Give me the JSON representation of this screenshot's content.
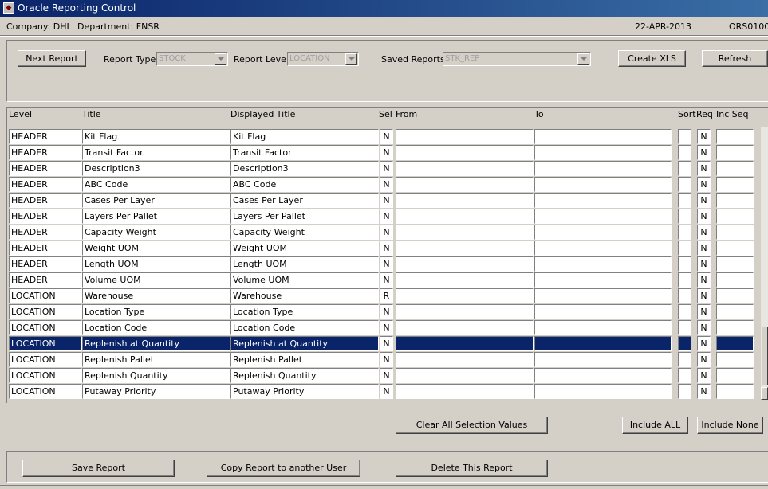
{
  "window": {
    "title": "Oracle Reporting Control"
  },
  "info": {
    "company": "Company:  DHL",
    "department": "Department:  FNSR",
    "date": "22-APR-2013",
    "code": "ORS0100"
  },
  "toolbar": {
    "next_report_label": "Next Report",
    "report_type_label": "Report Type",
    "report_type_value": "STOCK",
    "report_level_label": "Report Level",
    "report_level_value": "LOCATION",
    "saved_reports_label": "Saved Reports",
    "saved_reports_value": "STK_REP",
    "create_xls_label": "Create XLS",
    "refresh_label": "Refresh"
  },
  "grid": {
    "headers": {
      "level": "Level",
      "title": "Title",
      "displayed_title": "Displayed Title",
      "sel": "Sel",
      "from": "From",
      "to": "To",
      "sort": "Sort",
      "req": "Req",
      "inc_seq": "Inc Seq"
    },
    "selected_row": 13,
    "rows": [
      {
        "level": "HEADER",
        "title": "Kit Flag",
        "displayed": "Kit Flag",
        "sel": "N",
        "from": "",
        "to": "",
        "sort": "",
        "req": "N",
        "inc_seq": ""
      },
      {
        "level": "HEADER",
        "title": "Transit Factor",
        "displayed": "Transit Factor",
        "sel": "N",
        "from": "",
        "to": "",
        "sort": "",
        "req": "N",
        "inc_seq": ""
      },
      {
        "level": "HEADER",
        "title": "Description3",
        "displayed": "Description3",
        "sel": "N",
        "from": "",
        "to": "",
        "sort": "",
        "req": "N",
        "inc_seq": ""
      },
      {
        "level": "HEADER",
        "title": "ABC Code",
        "displayed": "ABC Code",
        "sel": "N",
        "from": "",
        "to": "",
        "sort": "",
        "req": "N",
        "inc_seq": ""
      },
      {
        "level": "HEADER",
        "title": "Cases Per Layer",
        "displayed": "Cases Per Layer",
        "sel": "N",
        "from": "",
        "to": "",
        "sort": "",
        "req": "N",
        "inc_seq": ""
      },
      {
        "level": "HEADER",
        "title": "Layers Per Pallet",
        "displayed": "Layers Per Pallet",
        "sel": "N",
        "from": "",
        "to": "",
        "sort": "",
        "req": "N",
        "inc_seq": ""
      },
      {
        "level": "HEADER",
        "title": "Capacity Weight",
        "displayed": "Capacity Weight",
        "sel": "N",
        "from": "",
        "to": "",
        "sort": "",
        "req": "N",
        "inc_seq": ""
      },
      {
        "level": "HEADER",
        "title": "Weight UOM",
        "displayed": "Weight UOM",
        "sel": "N",
        "from": "",
        "to": "",
        "sort": "",
        "req": "N",
        "inc_seq": ""
      },
      {
        "level": "HEADER",
        "title": "Length UOM",
        "displayed": "Length UOM",
        "sel": "N",
        "from": "",
        "to": "",
        "sort": "",
        "req": "N",
        "inc_seq": ""
      },
      {
        "level": "HEADER",
        "title": "Volume UOM",
        "displayed": "Volume UOM",
        "sel": "N",
        "from": "",
        "to": "",
        "sort": "",
        "req": "N",
        "inc_seq": ""
      },
      {
        "level": "LOCATION",
        "title": "Warehouse",
        "displayed": "Warehouse",
        "sel": "R",
        "from": "",
        "to": "",
        "sort": "",
        "req": "N",
        "inc_seq": ""
      },
      {
        "level": "LOCATION",
        "title": "Location Type",
        "displayed": "Location Type",
        "sel": "N",
        "from": "",
        "to": "",
        "sort": "",
        "req": "N",
        "inc_seq": ""
      },
      {
        "level": "LOCATION",
        "title": "Location Code",
        "displayed": "Location Code",
        "sel": "N",
        "from": "",
        "to": "",
        "sort": "",
        "req": "N",
        "inc_seq": ""
      },
      {
        "level": "LOCATION",
        "title": "Replenish at Quantity",
        "displayed": "Replenish at Quantity",
        "sel": "N",
        "from": "",
        "to": "",
        "sort": "",
        "req": "N",
        "inc_seq": ""
      },
      {
        "level": "LOCATION",
        "title": "Replenish Pallet",
        "displayed": "Replenish Pallet",
        "sel": "N",
        "from": "",
        "to": "",
        "sort": "",
        "req": "N",
        "inc_seq": ""
      },
      {
        "level": "LOCATION",
        "title": "Replenish Quantity",
        "displayed": "Replenish Quantity",
        "sel": "N",
        "from": "",
        "to": "",
        "sort": "",
        "req": "N",
        "inc_seq": ""
      },
      {
        "level": "LOCATION",
        "title": "Putaway Priority",
        "displayed": "Putaway Priority",
        "sel": "N",
        "from": "",
        "to": "",
        "sort": "",
        "req": "N",
        "inc_seq": ""
      }
    ]
  },
  "actions": {
    "clear_all_label": "Clear All Selection Values",
    "include_all_label": "Include ALL",
    "include_none_label": "Include None"
  },
  "footer": {
    "save_label": "Save Report",
    "copy_label": "Copy Report to another User",
    "delete_label": "Delete This Report"
  }
}
